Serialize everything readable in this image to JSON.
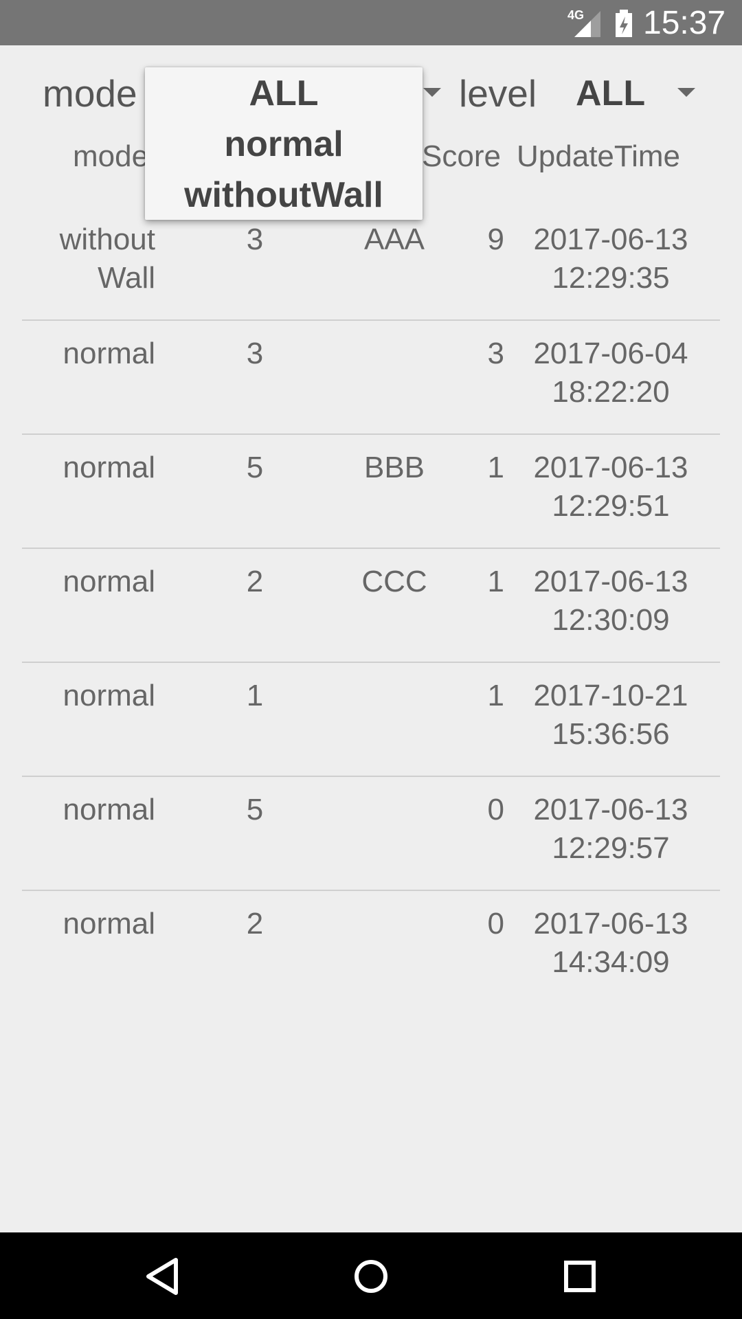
{
  "status_bar": {
    "network": "4G",
    "time": "15:37",
    "icons": [
      "signal-icon",
      "battery-icon"
    ]
  },
  "filters": {
    "mode_label": "mode",
    "level_label": "level",
    "level_value": "ALL"
  },
  "dropdown": {
    "options": [
      "ALL",
      "normal",
      "withoutWall"
    ]
  },
  "table": {
    "headers": {
      "mode": "mode",
      "score": "Score",
      "update_time": "UpdateTime"
    },
    "rows": [
      {
        "mode_line1": "without",
        "mode_line2": "Wall",
        "level": "3",
        "name": "AAA",
        "score": "9",
        "date": "2017-06-13",
        "time": "12:29:35"
      },
      {
        "mode_line1": "normal",
        "mode_line2": "",
        "level": "3",
        "name": "",
        "score": "3",
        "date": "2017-06-04",
        "time": "18:22:20"
      },
      {
        "mode_line1": "normal",
        "mode_line2": "",
        "level": "5",
        "name": "BBB",
        "score": "1",
        "date": "2017-06-13",
        "time": "12:29:51"
      },
      {
        "mode_line1": "normal",
        "mode_line2": "",
        "level": "2",
        "name": "CCC",
        "score": "1",
        "date": "2017-06-13",
        "time": "12:30:09"
      },
      {
        "mode_line1": "normal",
        "mode_line2": "",
        "level": "1",
        "name": "",
        "score": "1",
        "date": "2017-10-21",
        "time": "15:36:56"
      },
      {
        "mode_line1": "normal",
        "mode_line2": "",
        "level": "5",
        "name": "",
        "score": "0",
        "date": "2017-06-13",
        "time": "12:29:57"
      },
      {
        "mode_line1": "normal",
        "mode_line2": "",
        "level": "2",
        "name": "",
        "score": "0",
        "date": "2017-06-13",
        "time": "14:34:09"
      }
    ]
  },
  "nav": {
    "icons": [
      "back-icon",
      "home-icon",
      "recents-icon"
    ]
  }
}
